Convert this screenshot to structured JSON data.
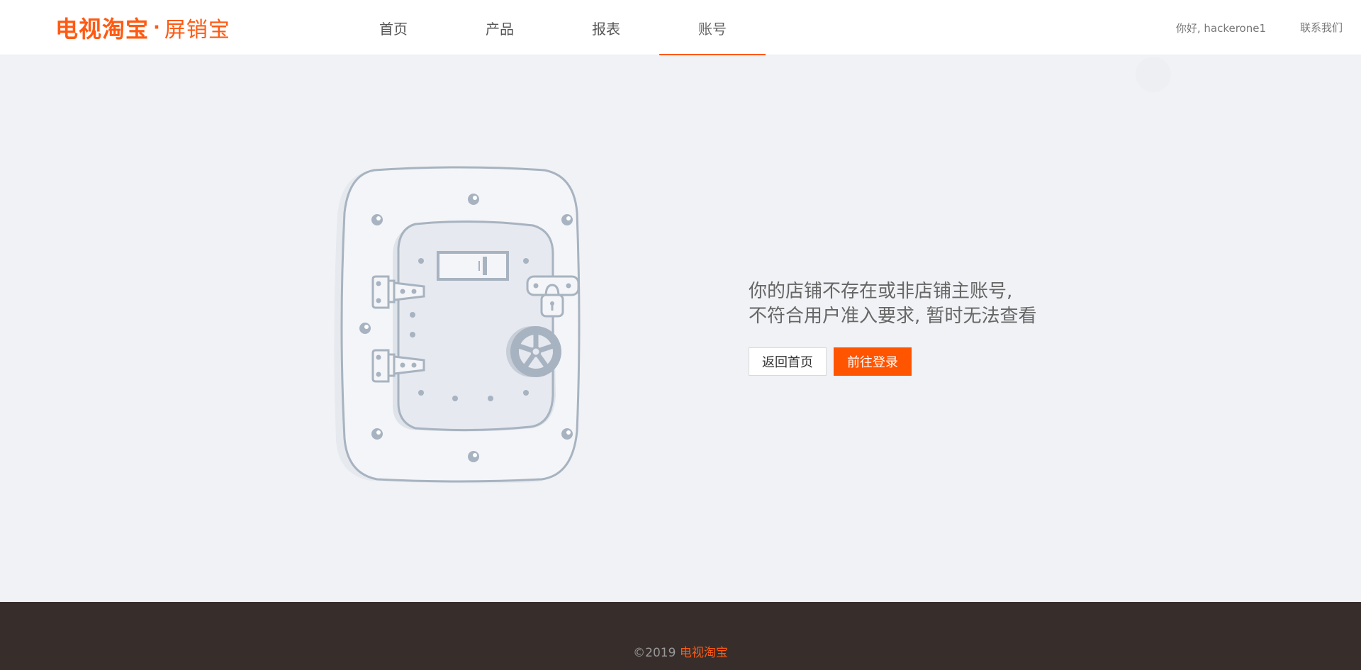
{
  "header": {
    "logo": {
      "brand": "电视淘宝",
      "separator": "·",
      "product": "屏销宝"
    },
    "nav": [
      {
        "label": "首页",
        "active": false
      },
      {
        "label": "产品",
        "active": false
      },
      {
        "label": "报表",
        "active": false
      },
      {
        "label": "账号",
        "active": true
      }
    ],
    "greeting": "你好, hackerone1",
    "contact_label": "联系我们"
  },
  "main": {
    "illustration_icon": "locked-vault-door-icon",
    "message_line1": "你的店铺不存在或非店铺主账号,",
    "message_line2": "不符合用户准入要求, 暂时无法查看",
    "back_button_label": "返回首页",
    "login_button_label": "前往登录"
  },
  "footer": {
    "copyright_prefix": "©2019 ",
    "copyright_brand": "电视淘宝"
  },
  "colors": {
    "accent": "#ff5a12",
    "button_primary": "#ff5400",
    "page_background": "#f0f2f5",
    "footer_background": "#372e2c"
  }
}
